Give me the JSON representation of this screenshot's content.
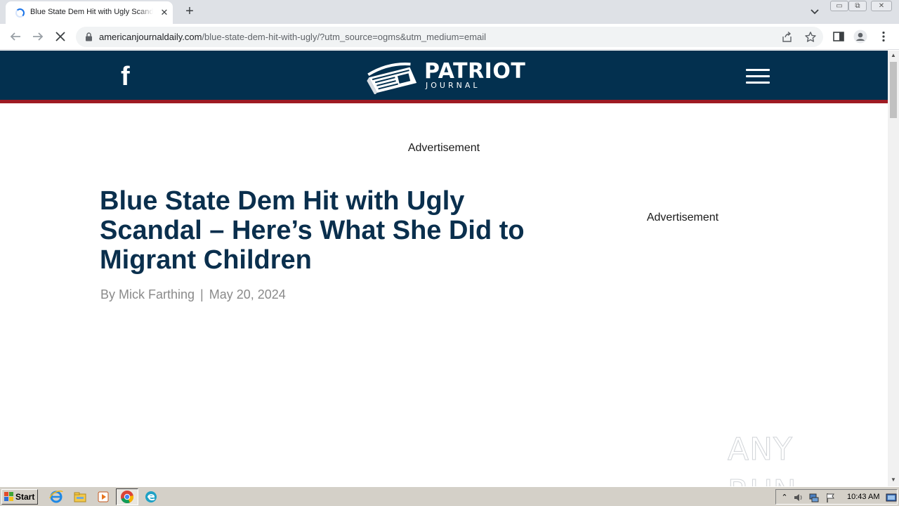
{
  "browser": {
    "tab_title": "Blue State Dem Hit with Ugly Scandal – Here’s What She Did to Migrant Children",
    "tab_close": "✕",
    "new_tab": "+",
    "url_host": "americanjournaldaily.com",
    "url_path": "/blue-state-dem-hit-with-ugly/?utm_source=ogms&utm_medium=email",
    "window_buttons": [
      "▭",
      "⧉",
      "✕"
    ]
  },
  "site": {
    "facebook_glyph": "f",
    "logo_name": "PATRIOT",
    "logo_sub": "JOURNAL",
    "colors": {
      "header": "#03304f",
      "accent_red": "#9e1b23",
      "headline": "#0a2f4d"
    }
  },
  "article": {
    "ad_top": "Advertisement",
    "headline": "Blue State Dem Hit with Ugly Scandal – Here’s What She Did to Migrant Children",
    "author": "By Mick Farthing",
    "separator": "|",
    "date": "May 20, 2024",
    "ad_side": "Advertisement"
  },
  "watermark": {
    "text": "ANY RUN"
  },
  "taskbar": {
    "start_label": "Start",
    "clock": "10:43 AM"
  }
}
